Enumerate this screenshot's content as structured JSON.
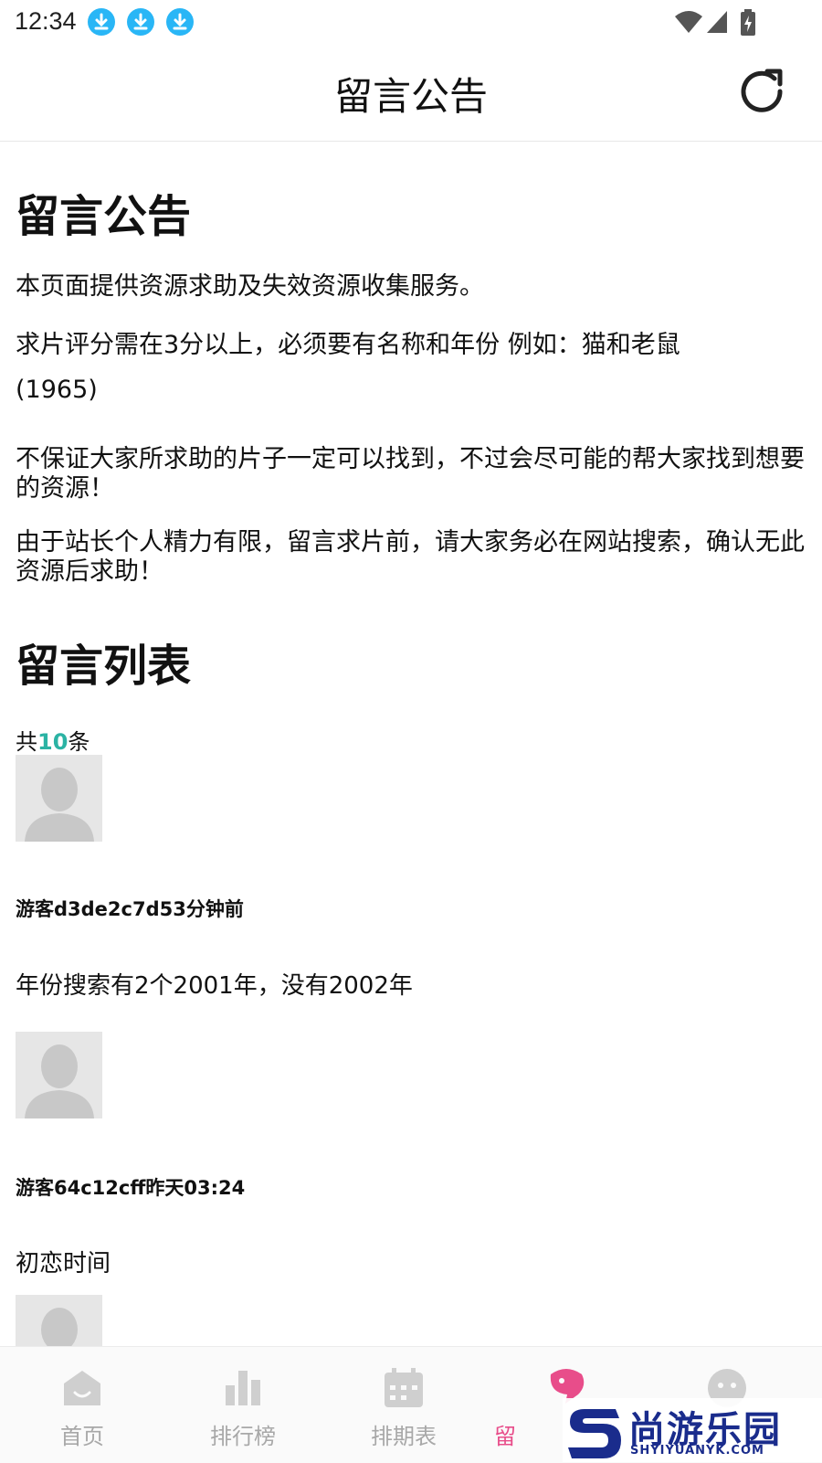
{
  "status": {
    "time": "12:34"
  },
  "header": {
    "title": "留言公告"
  },
  "notice": {
    "heading": "留言公告",
    "line1": "本页面提供资源求助及失效资源收集服务。",
    "line2a": "求片评分需在3分以上，必须要有名称和年份 例如：猫和老鼠",
    "line2b": "(1965)",
    "line3": "不保证大家所求助的片子一定可以找到，不过会尽可能的帮大家找到想要的资源！",
    "line4": "由于站长个人精力有限，留言求片前，请大家务必在网站搜索，确认无此资源后求助！"
  },
  "list": {
    "heading": "留言列表",
    "count_prefix": "共",
    "count": "10",
    "count_suffix": "条",
    "messages": [
      {
        "user_time": "游客d3de2c7d53分钟前",
        "text": "年份搜索有2个2001年，没有2002年"
      },
      {
        "user_time": "游客64c12cff昨天03:24",
        "text": "初恋时间"
      }
    ]
  },
  "nav": {
    "items": [
      {
        "label": "首页"
      },
      {
        "label": "排行榜"
      },
      {
        "label": "排期表"
      },
      {
        "label": "留"
      },
      {
        "label": ""
      }
    ]
  },
  "watermark": {
    "text": "尚游乐园",
    "sub": "SHYIYUANYK.COM",
    "letter": "S"
  },
  "colors": {
    "accent": "#2bb3a4",
    "active_tab": "#e84d8a",
    "download_icon": "#29b6f6"
  }
}
